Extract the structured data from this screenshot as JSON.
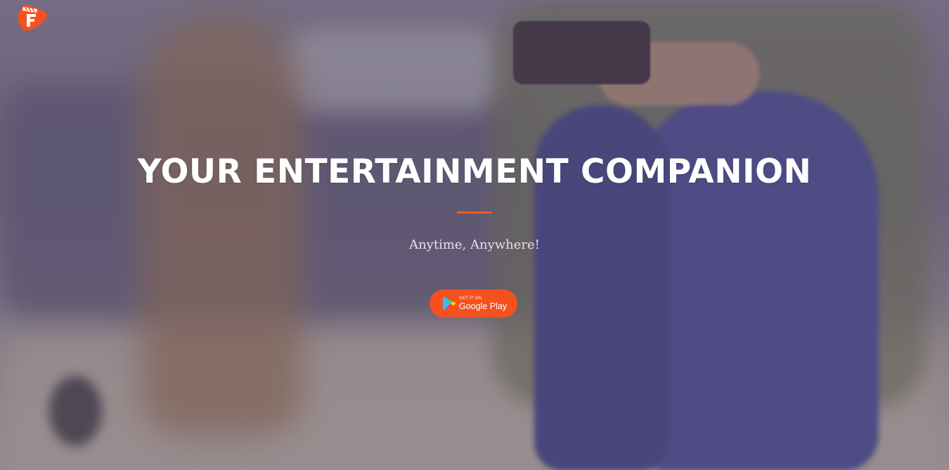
{
  "brand": {
    "logo_icon": "clapperboard-f-logo",
    "logo_color": "#f4511e"
  },
  "hero": {
    "headline": "YOUR ENTERTAINMENT COMPANION",
    "subtitle": "Anytime, Anywhere!",
    "divider_color": "#f05a22"
  },
  "cta": {
    "store_icon": "google-play-icon",
    "small_label": "GET IT ON",
    "big_label": "Google Play",
    "button_color": "#f4511e"
  }
}
